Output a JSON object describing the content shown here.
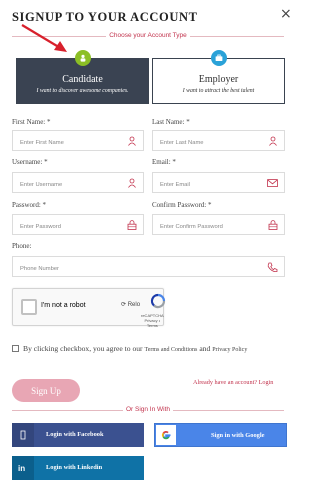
{
  "header": {
    "title": "SIGNUP TO YOUR ACCOUNT",
    "close_glyph": "×"
  },
  "account_type": {
    "divider_label": "Choose your Account Type",
    "candidate": {
      "name": "Candidate",
      "tagline": "I want to discover awesome companies.",
      "icon": "user-icon",
      "selected": true
    },
    "employer": {
      "name": "Employer",
      "tagline": "I want to attract the best talent",
      "icon": "briefcase-icon",
      "selected": false
    }
  },
  "form": {
    "first_name": {
      "label": "First Name: *",
      "placeholder": "Enter First Name",
      "icon": "user-icon"
    },
    "last_name": {
      "label": "Last Name: *",
      "placeholder": "Enter Last Name",
      "icon": "user-icon"
    },
    "username": {
      "label": "Username: *",
      "placeholder": "Enter Username",
      "icon": "user-icon"
    },
    "email": {
      "label": "Email: *",
      "placeholder": "Enter Email",
      "icon": "envelope-icon"
    },
    "password": {
      "label": "Password: *",
      "placeholder": "Enter Password",
      "icon": "lock-icon"
    },
    "confirm_password": {
      "label": "Confirm Password: *",
      "placeholder": "Enter Confirm Password",
      "icon": "lock-icon"
    },
    "phone": {
      "label": "Phone:",
      "placeholder": "Phone Number",
      "icon": "phone-icon"
    }
  },
  "recaptcha": {
    "label": "I'm not a robot",
    "reload_label": "Relo",
    "brand": "reCAPTCHA",
    "links": "Privacy • Terms"
  },
  "terms": {
    "text": "By clicking checkbox, you agree to our",
    "link": "Terms and Conditions",
    "and": "and",
    "link2": "Privacy Policy"
  },
  "actions": {
    "signup_label": "Sign Up",
    "login_link": "Already have an account? Login"
  },
  "social": {
    "divider_label": "Or Sign In With",
    "facebook_label": "Login with Facebook",
    "google_label": "Sign in with Google",
    "linkedin_label": "Login with Linkedin"
  },
  "colors": {
    "accent": "#c2334d",
    "candidate_bg": "#3a4352",
    "facebook": "#3b5190",
    "google": "#4a85e8",
    "linkedin": "#0f72a6",
    "signup": "#e8a6b4"
  }
}
